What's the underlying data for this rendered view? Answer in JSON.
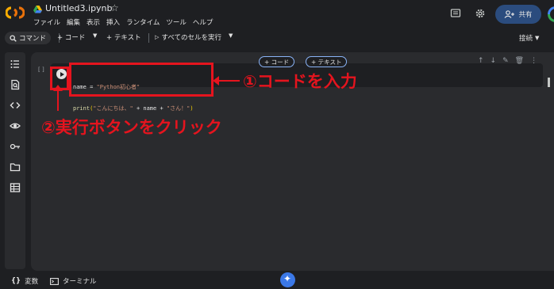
{
  "header": {
    "notebook_title": "Untitled3.ipynb",
    "star_glyph": "☆",
    "menu": [
      "ファイル",
      "編集",
      "表示",
      "挿入",
      "ランタイム",
      "ツール",
      "ヘルプ"
    ],
    "share_label": "共有"
  },
  "toolbar": {
    "command_label": "コマンド",
    "add_code_label": "+ コード",
    "add_text_label": "+ テキスト",
    "run_all_label": "すべてのセルを実行",
    "connect_label": "接続"
  },
  "cell": {
    "bracket": "[ ]",
    "add_code_label": "+ コード",
    "add_text_label": "+ テキスト",
    "code": {
      "line1": {
        "var": "name",
        "op": " = ",
        "str": "\"Python初心者\""
      },
      "line2": {
        "fn": "print",
        "open": "(",
        "str1": "\"こんにちは、\"",
        "op1": " + name + ",
        "str2": "\"さん！\"",
        "close": ")"
      }
    }
  },
  "annotations": {
    "step1": "①コードを入力",
    "step2": "②実行ボタンをクリック",
    "color": "#e5141e"
  },
  "bottombar": {
    "variables_label": "変数",
    "terminal_label": "ターミナル"
  },
  "colors": {
    "background": "#1e1f22",
    "panel": "#2a2b2e",
    "accent": "#8ab4f8",
    "share_bg": "#2b4c7e"
  }
}
